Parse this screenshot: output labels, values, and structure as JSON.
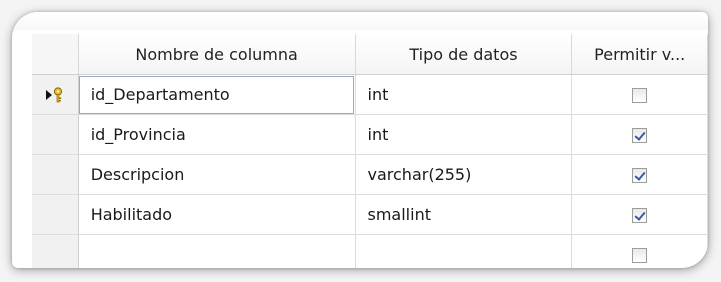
{
  "headers": {
    "column_name": "Nombre de columna",
    "data_type": "Tipo de datos",
    "allow_nulls": "Permitir v..."
  },
  "icons": {
    "current_row": "arrow-icon",
    "primary_key": "key-icon"
  },
  "colors": {
    "key_gold": "#d4a017",
    "check_blue": "#3b5a9c"
  },
  "rows": [
    {
      "column_name": "id_Departamento",
      "data_type": "int",
      "allow_nulls": false,
      "primary_key": true,
      "current": true
    },
    {
      "column_name": "id_Provincia",
      "data_type": "int",
      "allow_nulls": true,
      "primary_key": false,
      "current": false
    },
    {
      "column_name": "Descripcion",
      "data_type": "varchar(255)",
      "allow_nulls": true,
      "primary_key": false,
      "current": false
    },
    {
      "column_name": "Habilitado",
      "data_type": "smallint",
      "allow_nulls": true,
      "primary_key": false,
      "current": false
    },
    {
      "column_name": "",
      "data_type": "",
      "allow_nulls": false,
      "primary_key": false,
      "current": false
    }
  ]
}
